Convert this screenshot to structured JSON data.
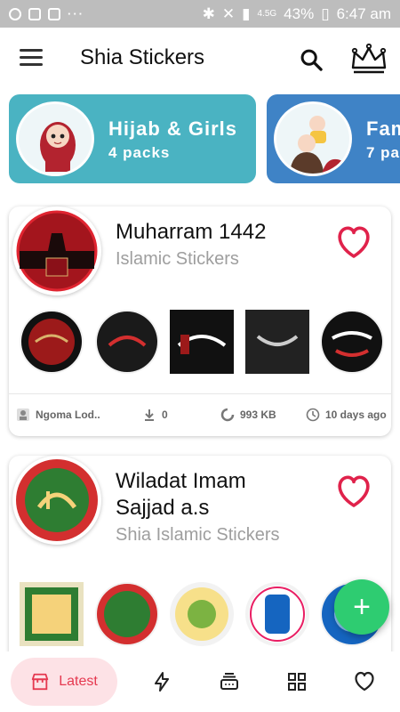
{
  "status_bar": {
    "battery": "43%",
    "time": "6:47 am",
    "network": "4.5G"
  },
  "app": {
    "title": "Shia Stickers"
  },
  "categories": [
    {
      "title": "Hijab & Girls",
      "subtitle": "4 packs",
      "color": "#4ab3c2"
    },
    {
      "title": "Fam",
      "subtitle": "7 pa",
      "color": "#3f83c6"
    }
  ],
  "packs": [
    {
      "name": "Muharram 1442",
      "subtitle": "Islamic Stickers",
      "author": "Ngoma Lod..",
      "downloads": "0",
      "size": "993 KB",
      "time": "10 days ago"
    },
    {
      "name_line1": "Wiladat Imam",
      "name_line2": "Sajjad a.s",
      "subtitle": "Shia Islamic Stickers"
    }
  ],
  "nav": {
    "latest_label": "Latest"
  },
  "colors": {
    "accent": "#e53950",
    "fab": "#2ecc71",
    "heart": "#e0224b"
  }
}
